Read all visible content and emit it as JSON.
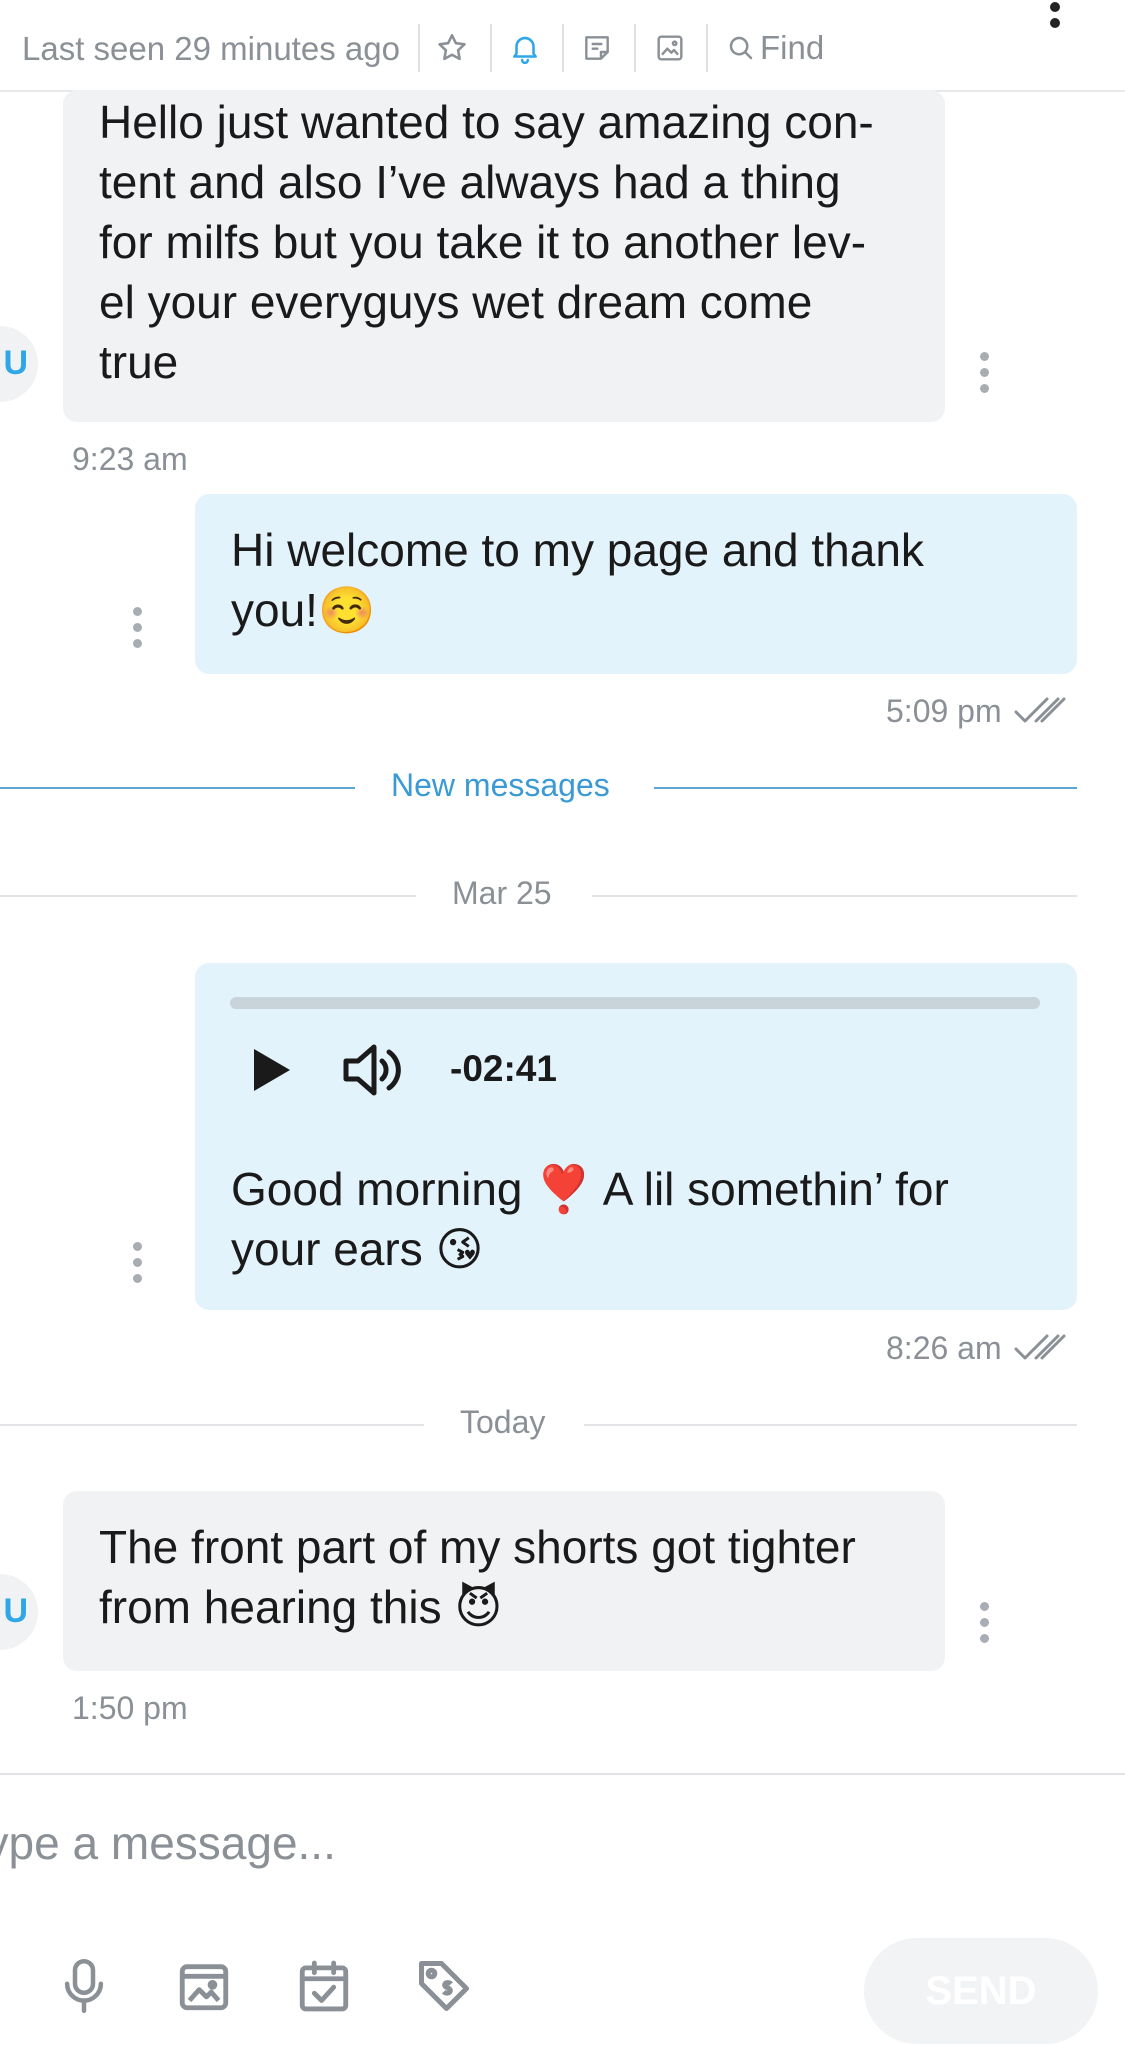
{
  "header": {
    "last_seen": "Last seen 29 minutes ago",
    "find_label": "Find",
    "icons": [
      "star-icon",
      "bell-icon",
      "note-icon",
      "image-icon",
      "search-icon",
      "more-vertical-icon"
    ],
    "bell_active_color": "#2fa7e6"
  },
  "messages": [
    {
      "direction": "incoming",
      "avatar_initial": "U",
      "lines": [
        "Hello just wanted to say amazing con-",
        "tent and also I’ve always had a thing",
        "for milfs but you take it to another lev-",
        "el your everyguys wet dream come",
        "true"
      ],
      "time": "9:23 am"
    },
    {
      "direction": "outgoing",
      "lines": [
        "Hi welcome to my page and thank",
        "you!☺️"
      ],
      "time": "5:09 pm",
      "read": true
    }
  ],
  "new_messages_label": "New messages",
  "date_mar25": "Mar 25",
  "audio_message": {
    "direction": "outgoing",
    "remaining": "-02:41",
    "lines": [
      "Good morning ❣️ A lil somethin’ for",
      "your ears 😘"
    ],
    "time": "8:26 am",
    "read": true
  },
  "date_today": "Today",
  "today_message": {
    "direction": "incoming",
    "avatar_initial": "U",
    "lines": [
      "The front part of my shorts got tighter",
      "from hearing this 😈"
    ],
    "time": "1:50 pm"
  },
  "composer": {
    "placeholder": "Type a message...",
    "send_label": "SEND",
    "tools": [
      "microphone-icon",
      "media-icon",
      "calendar-icon",
      "price-tag-icon"
    ]
  },
  "colors": {
    "accent": "#2fa7e6",
    "incoming_bubble": "#f1f2f4",
    "outgoing_bubble": "#e3f3fc"
  }
}
